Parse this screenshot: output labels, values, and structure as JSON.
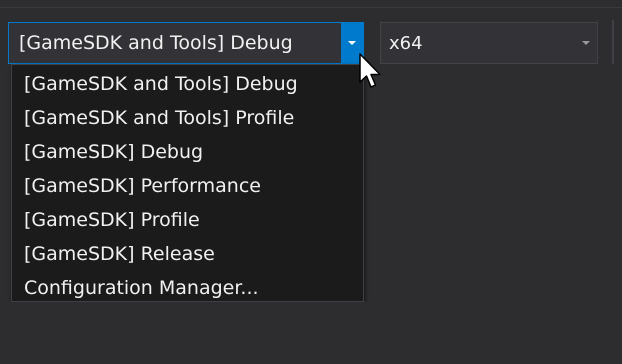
{
  "toolbar": {
    "configuration": {
      "selected": "[GameSDK and Tools] Debug",
      "options": [
        "[GameSDK and Tools] Debug",
        "[GameSDK and Tools] Profile",
        "[GameSDK] Debug",
        "[GameSDK] Performance",
        "[GameSDK] Profile",
        "[GameSDK] Release",
        "Configuration Manager..."
      ]
    },
    "platform": {
      "selected": "x64"
    }
  },
  "colors": {
    "background": "#2d2d30",
    "dropdown_bg": "#1b1b1c",
    "accent": "#007acc",
    "text": "#f1f1f1"
  },
  "icons": {
    "config_arrow": "chevron-down-icon",
    "platform_arrow": "chevron-down-icon",
    "cursor": "mouse-pointer-icon"
  }
}
